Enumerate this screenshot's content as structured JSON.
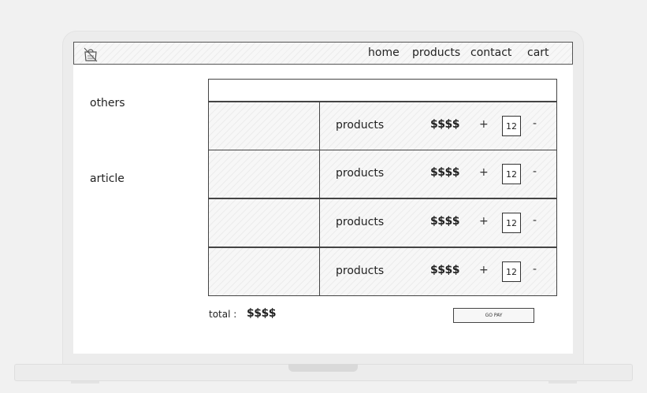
{
  "nav": {
    "home": "home",
    "products": "products",
    "contact": "contact",
    "cart": "cart"
  },
  "sidebar": {
    "others": "others",
    "article": "article"
  },
  "cart": {
    "items": [
      {
        "name": "products",
        "price": "$$$$",
        "plus": "+",
        "quantity": "12",
        "minus": "-"
      },
      {
        "name": "products",
        "price": "$$$$",
        "plus": "+",
        "quantity": "12",
        "minus": "-"
      },
      {
        "name": "products",
        "price": "$$$$",
        "plus": "+",
        "quantity": "12",
        "minus": "-"
      },
      {
        "name": "products",
        "price": "$$$$",
        "plus": "+",
        "quantity": "12",
        "minus": "-"
      }
    ],
    "total_label": "total :",
    "total_value": "$$$$",
    "go_label": "GO PAY"
  },
  "icons": {
    "logo": "shopping-bag-logo-icon"
  }
}
